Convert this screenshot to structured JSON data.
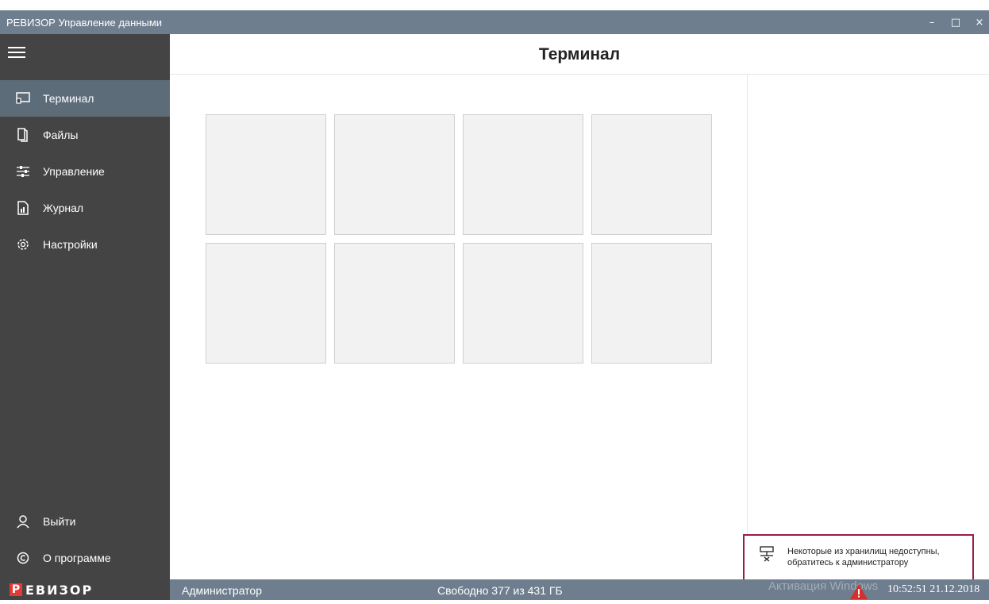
{
  "window": {
    "title": "РЕВИЗОР Управление данными",
    "controls": {
      "minimize": "–",
      "maximize": "□",
      "close": "×"
    }
  },
  "header": {
    "title": "Терминал"
  },
  "sidebar": {
    "items": [
      {
        "label": "Терминал",
        "icon": "terminal-icon",
        "active": true
      },
      {
        "label": "Файлы",
        "icon": "files-icon",
        "active": false
      },
      {
        "label": "Управление",
        "icon": "sliders-icon",
        "active": false
      },
      {
        "label": "Журнал",
        "icon": "journal-icon",
        "active": false
      },
      {
        "label": "Настройки",
        "icon": "gear-icon",
        "active": false
      }
    ],
    "bottom_items": [
      {
        "label": "Выйти",
        "icon": "user-icon"
      },
      {
        "label": "О программе",
        "icon": "copyright-icon"
      }
    ]
  },
  "tiles": {
    "count": 8,
    "rows": 2,
    "cols": 4
  },
  "notification": {
    "line1": "Некоторые из хранилищ недоступны,",
    "line2": "обратитесь к администратору",
    "icon": "storage-offline-icon"
  },
  "statusbar": {
    "logo_letter": "Р",
    "logo_text": "ЕВИЗОР",
    "user": "Администратор",
    "free_space": "Свободно 377 из 431 ГБ",
    "watermark": "Активация Windows",
    "time": "10:52:51 21.12.2018"
  },
  "colors": {
    "titlebar": "#6e7e8e",
    "sidebar": "#444444",
    "sidebar_active": "#5d6c79",
    "notification_border": "#9c1b47",
    "logo_red": "#e53935",
    "warning_red": "#d32f2f"
  }
}
